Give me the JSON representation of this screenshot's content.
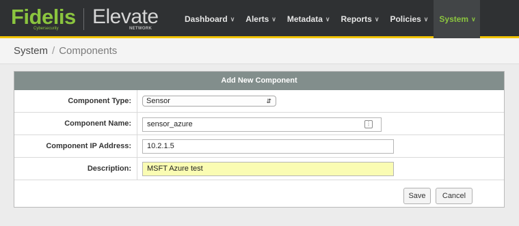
{
  "brand": {
    "name": "Fidelis",
    "sub": "Cybersecurity",
    "product": "Elevate",
    "product_sub": "NETWORK"
  },
  "nav": {
    "items": [
      {
        "label": "Dashboard",
        "active": false
      },
      {
        "label": "Alerts",
        "active": false
      },
      {
        "label": "Metadata",
        "active": false
      },
      {
        "label": "Reports",
        "active": false
      },
      {
        "label": "Policies",
        "active": false
      },
      {
        "label": "System",
        "active": true
      }
    ],
    "chevron": "∨"
  },
  "breadcrumb": {
    "root": "System",
    "separator": "/",
    "current": "Components"
  },
  "form": {
    "title": "Add New Component",
    "component_type": {
      "label": "Component Type:",
      "value": "Sensor"
    },
    "component_name": {
      "label": "Component Name:",
      "value": "sensor_azure"
    },
    "component_ip": {
      "label": "Component IP Address:",
      "value": "10.2.1.5"
    },
    "description": {
      "label": "Description:",
      "value": "MSFT Azure test"
    }
  },
  "buttons": {
    "save": "Save",
    "cancel": "Cancel"
  },
  "colors": {
    "topbar": "#2f3133",
    "accent_green": "#8bc53f",
    "accent_yellow": "#f2c400",
    "panel_header": "#828e8c",
    "highlight_field": "#fafcb3"
  }
}
